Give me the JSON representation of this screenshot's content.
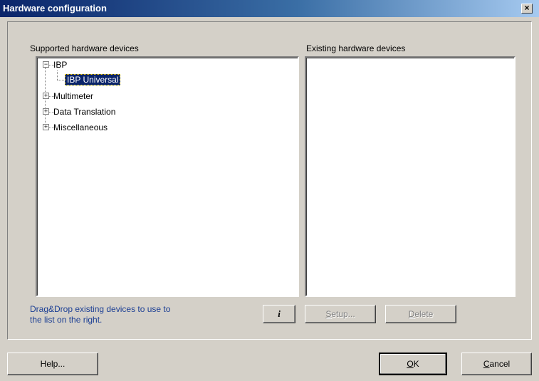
{
  "window": {
    "title": "Hardware configuration",
    "close_glyph": "×"
  },
  "supported": {
    "label": "Supported hardware devices",
    "tree": [
      {
        "label": "IBP",
        "expanded": true,
        "expander": "−"
      },
      {
        "label": "IBP Universal",
        "selected": true
      },
      {
        "label": "Multimeter",
        "expanded": false,
        "expander": "+"
      },
      {
        "label": "Data Translation",
        "expanded": false,
        "expander": "+"
      },
      {
        "label": "Miscellaneous",
        "expanded": false,
        "expander": "+"
      }
    ]
  },
  "existing": {
    "label": "Existing hardware devices"
  },
  "hint": {
    "line1": "Drag&Drop existing devices to use to",
    "line2": "the list on the right."
  },
  "buttons": {
    "info": "i",
    "setup_mn": "S",
    "setup_rest": "etup...",
    "delete_mn": "D",
    "delete_rest": "elete",
    "help": "Help...",
    "ok_mn": "O",
    "ok_rest": "K",
    "cancel_mn": "C",
    "cancel_rest": "ancel"
  },
  "colors": {
    "title_gradient_start": "#0a246a",
    "selection": "#0a246a",
    "hint_text": "#1c3f94",
    "face": "#d4d0c8"
  }
}
